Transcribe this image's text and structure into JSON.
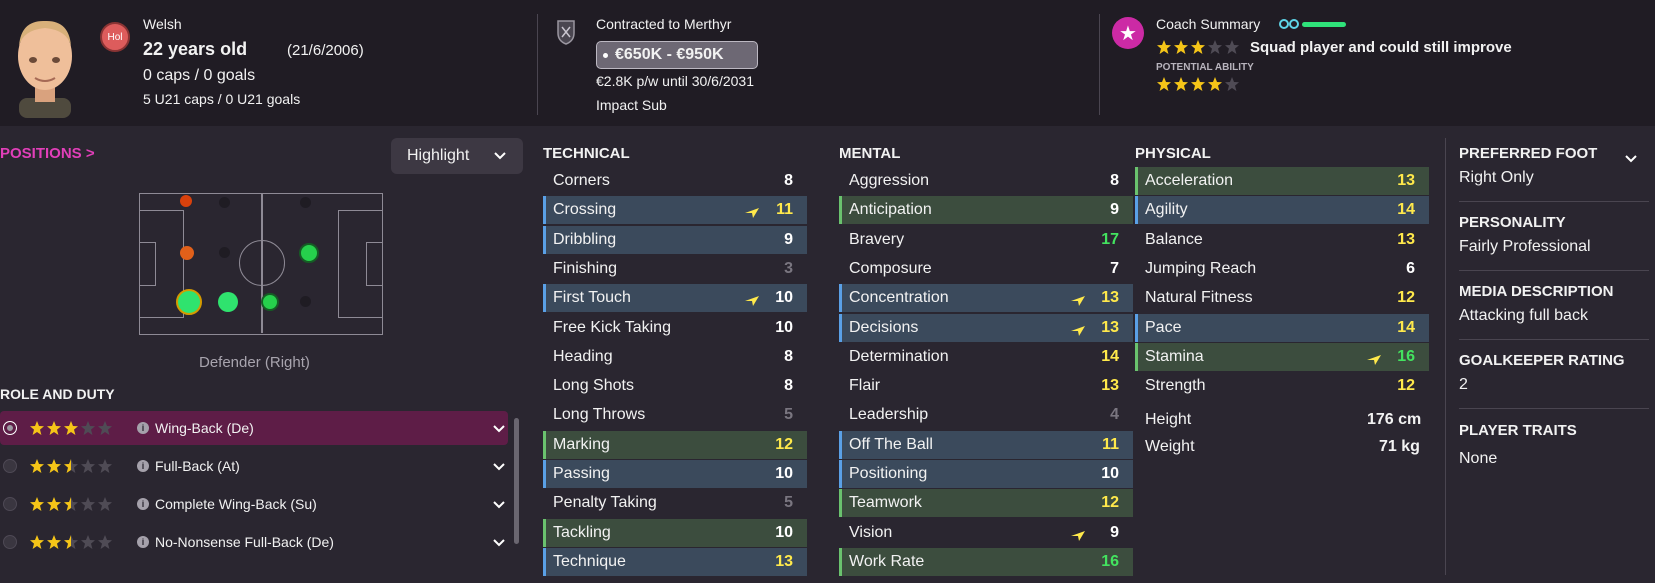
{
  "header": {
    "nation_badge": "Hol",
    "nationality": "Welsh",
    "age_text": "22 years old",
    "dob": "(21/6/2006)",
    "caps": "0 caps / 0 goals",
    "u21_caps": "5 U21 caps / 0 U21 goals",
    "contract_title": "Contracted to Merthyr",
    "value_range": "€650K - €950K",
    "wage": "€2.8K p/w until 30/6/2031",
    "squad_status": "Impact Sub",
    "coach_title": "Coach Summary",
    "coach_text": "Squad player and could still improve",
    "potential_label": "POTENTIAL ABILITY",
    "current_ability_stars": 3,
    "potential_ability_stars": 4
  },
  "positions": {
    "title": "POSITIONS >",
    "highlight_label": "Highlight",
    "caption": "Defender (Right)"
  },
  "roles": {
    "title": "ROLE AND DUTY",
    "items": [
      {
        "label": "Wing-Back (De)",
        "stars": 3,
        "active": true
      },
      {
        "label": "Full-Back (At)",
        "stars": 2.5,
        "active": false
      },
      {
        "label": "Complete Wing-Back (Su)",
        "stars": 2.5,
        "active": false
      },
      {
        "label": "No-Nonsense Full-Back (De)",
        "stars": 2.5,
        "active": false
      }
    ]
  },
  "technical": {
    "title": "TECHNICAL",
    "attrs": [
      {
        "name": "Corners",
        "value": "8"
      },
      {
        "name": "Crossing",
        "value": "11"
      },
      {
        "name": "Dribbling",
        "value": "9"
      },
      {
        "name": "Finishing",
        "value": "3"
      },
      {
        "name": "First Touch",
        "value": "10"
      },
      {
        "name": "Free Kick Taking",
        "value": "10"
      },
      {
        "name": "Heading",
        "value": "8"
      },
      {
        "name": "Long Shots",
        "value": "8"
      },
      {
        "name": "Long Throws",
        "value": "5"
      },
      {
        "name": "Marking",
        "value": "12"
      },
      {
        "name": "Passing",
        "value": "10"
      },
      {
        "name": "Penalty Taking",
        "value": "5"
      },
      {
        "name": "Tackling",
        "value": "10"
      },
      {
        "name": "Technique",
        "value": "13"
      }
    ]
  },
  "mental": {
    "title": "MENTAL",
    "attrs": [
      {
        "name": "Aggression",
        "value": "8"
      },
      {
        "name": "Anticipation",
        "value": "9"
      },
      {
        "name": "Bravery",
        "value": "17"
      },
      {
        "name": "Composure",
        "value": "7"
      },
      {
        "name": "Concentration",
        "value": "13"
      },
      {
        "name": "Decisions",
        "value": "13"
      },
      {
        "name": "Determination",
        "value": "14"
      },
      {
        "name": "Flair",
        "value": "13"
      },
      {
        "name": "Leadership",
        "value": "4"
      },
      {
        "name": "Off The Ball",
        "value": "11"
      },
      {
        "name": "Positioning",
        "value": "10"
      },
      {
        "name": "Teamwork",
        "value": "12"
      },
      {
        "name": "Vision",
        "value": "9"
      },
      {
        "name": "Work Rate",
        "value": "16"
      }
    ]
  },
  "physical": {
    "title": "PHYSICAL",
    "attrs": [
      {
        "name": "Acceleration",
        "value": "13"
      },
      {
        "name": "Agility",
        "value": "14"
      },
      {
        "name": "Balance",
        "value": "13"
      },
      {
        "name": "Jumping Reach",
        "value": "6"
      },
      {
        "name": "Natural Fitness",
        "value": "12"
      },
      {
        "name": "Pace",
        "value": "14"
      },
      {
        "name": "Stamina",
        "value": "16"
      },
      {
        "name": "Strength",
        "value": "12"
      }
    ],
    "height_label": "Height",
    "height_value": "176 cm",
    "weight_label": "Weight",
    "weight_value": "71 kg"
  },
  "info_panel": {
    "preferred_foot_label": "PREFERRED FOOT",
    "preferred_foot_value": "Right Only",
    "personality_label": "PERSONALITY",
    "personality_value": "Fairly Professional",
    "media_label": "MEDIA DESCRIPTION",
    "media_value": "Attacking full back",
    "gk_label": "GOALKEEPER RATING",
    "gk_value": "2",
    "traits_label": "PLAYER TRAITS",
    "traits_value": "None"
  },
  "colors": {
    "accent_pink": "#e13fb9",
    "star_gold": "#f5c518",
    "green_attr": "#43e35f",
    "yellow_attr": "#ffe94b"
  }
}
